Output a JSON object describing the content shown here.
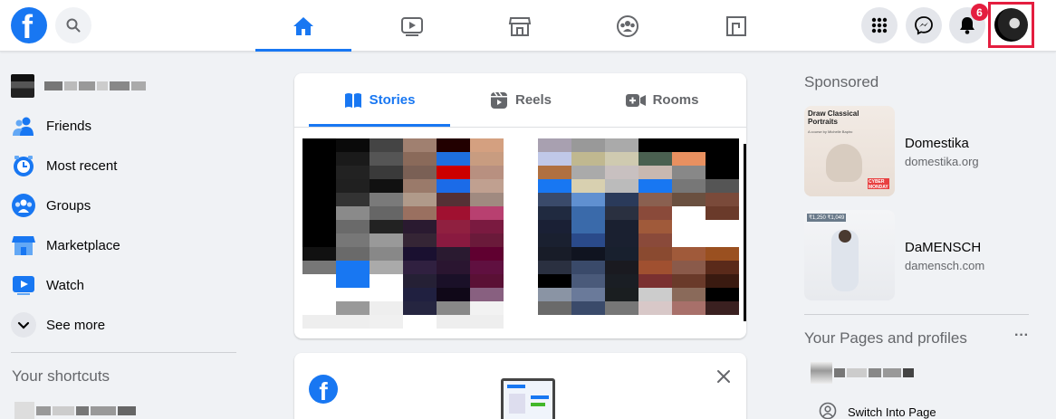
{
  "header": {
    "logo_letter": "f",
    "notification_count": "6",
    "nav_tabs": [
      {
        "name": "home",
        "icon": "home-icon",
        "active": true
      },
      {
        "name": "watch",
        "icon": "video-icon",
        "active": false
      },
      {
        "name": "marketplace",
        "icon": "store-icon",
        "active": false
      },
      {
        "name": "groups",
        "icon": "groups-icon",
        "active": false
      },
      {
        "name": "gaming",
        "icon": "gaming-icon",
        "active": false
      }
    ],
    "accent": "#1877f2",
    "badge_color": "#e41e3f"
  },
  "sidebar": {
    "items": [
      {
        "label": "Friends",
        "icon": "friends-icon"
      },
      {
        "label": "Most recent",
        "icon": "clock-feed-icon"
      },
      {
        "label": "Groups",
        "icon": "groups-icon"
      },
      {
        "label": "Marketplace",
        "icon": "store-icon"
      },
      {
        "label": "Watch",
        "icon": "video-icon"
      },
      {
        "label": "See more",
        "icon": "chevron-down-icon"
      }
    ],
    "shortcuts_title": "Your shortcuts"
  },
  "stories": {
    "tabs": [
      {
        "label": "Stories",
        "icon": "book-icon",
        "active": true
      },
      {
        "label": "Reels",
        "icon": "reels-icon",
        "active": false
      },
      {
        "label": "Rooms",
        "icon": "video-plus-icon",
        "active": false
      }
    ]
  },
  "right": {
    "sponsored_title": "Sponsored",
    "ads": [
      {
        "name": "Domestika",
        "url": "domestika.org",
        "img_heading": "Draw Classical Portraits",
        "img_sub": "A course by Michelle Bapiro",
        "img_tag": "CYBER MONDAY"
      },
      {
        "name": "DaMENSCH",
        "url": "damensch.com",
        "img_price": "₹1,250 ₹1,049"
      }
    ],
    "pages_title": "Your Pages and profiles",
    "switch_label": "Switch Into Page"
  }
}
